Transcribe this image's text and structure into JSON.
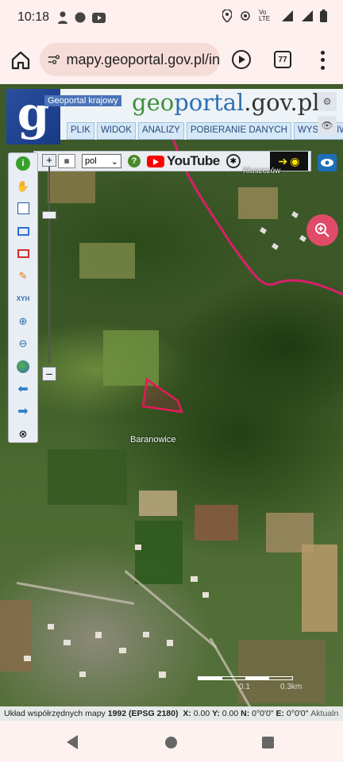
{
  "status_bar": {
    "time": "10:18",
    "network": "Vo LTE",
    "lte_label": "LTE"
  },
  "browser": {
    "url": "mapy.geoportal.gov.pl/in",
    "tab_count": "77"
  },
  "geoportal": {
    "logo_letter": "g",
    "portal_label": "Geoportal krajowy",
    "title_prefix": "geo",
    "title_middle": "portal",
    "title_suffix": ".gov.pl",
    "menu": [
      "PLIK",
      "WIDOK",
      "ANALIZY",
      "POBIERANIE DANYCH",
      "WYSZUKIWAN"
    ],
    "toolbar": {
      "language": "pol",
      "help": "?",
      "youtube": "YouTube"
    },
    "tools": {
      "xyh": "XYH"
    }
  },
  "map": {
    "place_label": "Baranowice",
    "town_label": "Kluszczów",
    "scale_left": "0.1",
    "scale_right": "0.3km"
  },
  "coord_bar": {
    "label": "Układ współrzędnych mapy",
    "system_label": "1992 (EPSG 2180)",
    "x_label": "X:",
    "x_value": "0.00",
    "y_label": "Y:",
    "y_value": "0.00",
    "n_label": "N:",
    "n_value": "0°0'0\"",
    "e_label": "E:",
    "e_value": "0°0'0\"",
    "extra": "Aktualn"
  },
  "colors": {
    "accent_blue": "#2c6fb3",
    "parcel_outline": "#e8185a",
    "zoom_fab": "#e04b6a"
  }
}
